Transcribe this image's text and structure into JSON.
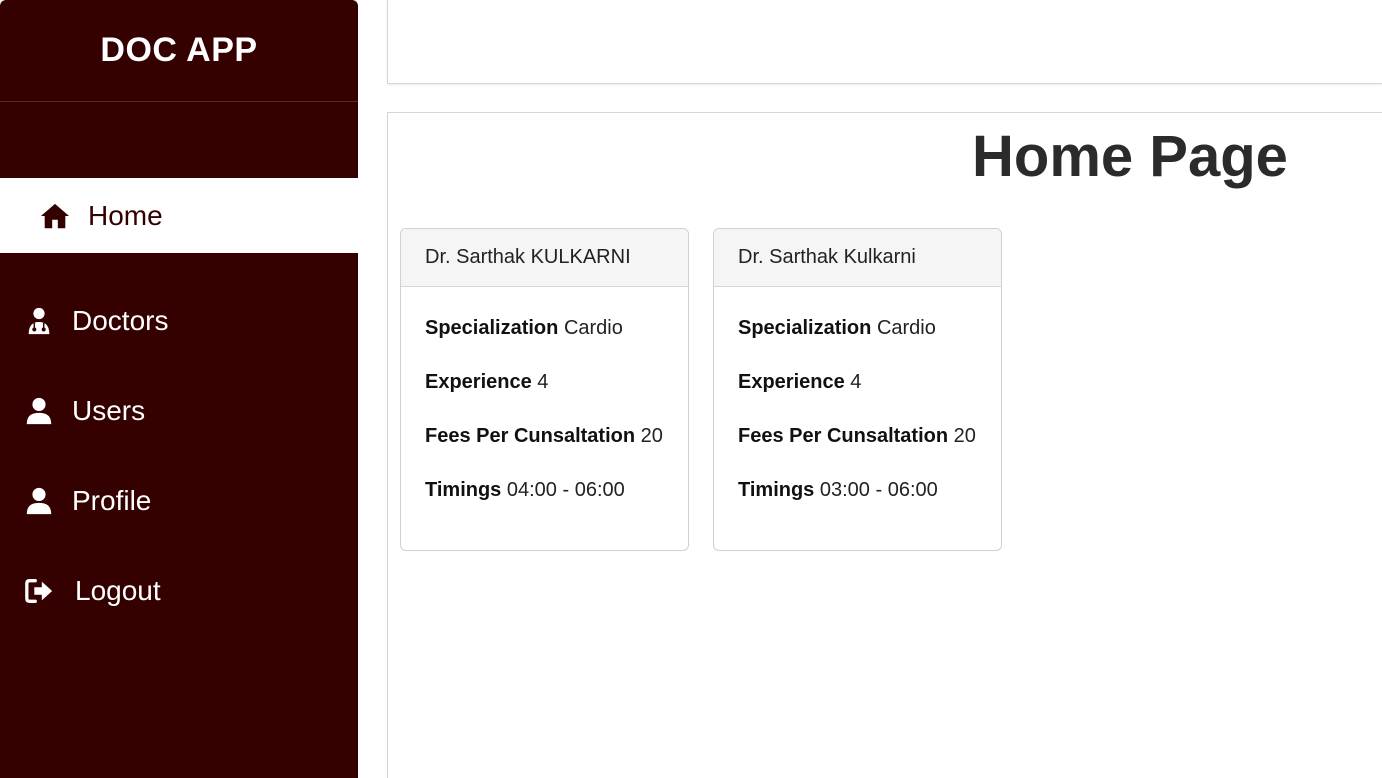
{
  "app": {
    "title": "DOC APP"
  },
  "sidebar": {
    "items": [
      {
        "label": "Home",
        "icon": "home-icon",
        "active": true
      },
      {
        "label": "Doctors",
        "icon": "doctor-icon",
        "active": false
      },
      {
        "label": "Users",
        "icon": "user-icon",
        "active": false
      },
      {
        "label": "Profile",
        "icon": "user-icon",
        "active": false
      },
      {
        "label": "Logout",
        "icon": "logout-icon",
        "active": false
      }
    ]
  },
  "main": {
    "title": "Home Page",
    "doctors": [
      {
        "name": "Dr. Sarthak KULKARNI",
        "specialization_label": "Specialization",
        "specialization": "Cardio",
        "experience_label": "Experience",
        "experience": "4",
        "fees_label": "Fees Per Cunsaltation",
        "fees": "20",
        "timings_label": "Timings",
        "timings": "04:00 - 06:00"
      },
      {
        "name": "Dr. Sarthak Kulkarni",
        "specialization_label": "Specialization",
        "specialization": "Cardio",
        "experience_label": "Experience",
        "experience": "4",
        "fees_label": "Fees Per Cunsaltation",
        "fees": "20",
        "timings_label": "Timings",
        "timings": "03:00 - 06:00"
      }
    ]
  },
  "colors": {
    "sidebar_bg": "#340000",
    "active_bg": "#ffffff",
    "text_light": "#ffffff"
  }
}
